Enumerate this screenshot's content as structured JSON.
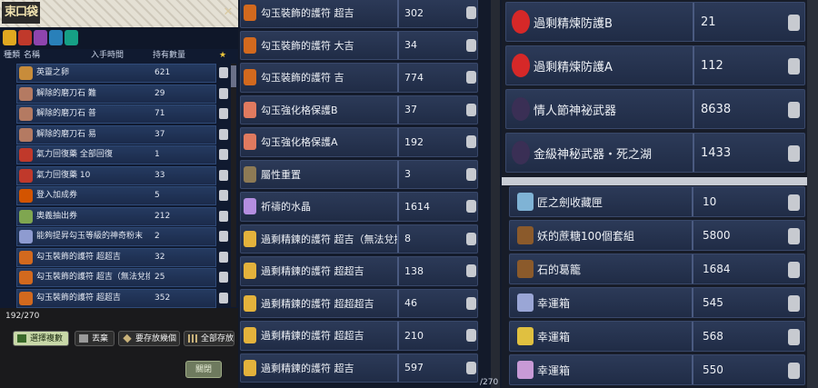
{
  "inventory": {
    "title": "束口袋",
    "close_glyph": "✕",
    "headers": {
      "type": "種類",
      "name": "名稱",
      "date": "入手時間",
      "qty": "持有數量",
      "star": "★"
    },
    "items": [
      {
        "name": "英靈之卵",
        "qty": "621",
        "color": "#c88c3a"
      },
      {
        "name": "解除的磨刀石 難",
        "qty": "29",
        "color": "#b47a62"
      },
      {
        "name": "解除的磨刀石 普",
        "qty": "71",
        "color": "#b47a62"
      },
      {
        "name": "解除的磨刀石 易",
        "qty": "37",
        "color": "#b47a62"
      },
      {
        "name": "氣力回復藥 全部回復",
        "qty": "1",
        "color": "#c0392b"
      },
      {
        "name": "氣力回復藥 10",
        "qty": "33",
        "color": "#c0392b"
      },
      {
        "name": "登入加成券",
        "qty": "5",
        "color": "#d35400"
      },
      {
        "name": "奧義抽出券",
        "qty": "212",
        "color": "#7fa650"
      },
      {
        "name": "能夠提昇勾玉等級的神奇粉末",
        "qty": "2",
        "color": "#8e9bd0"
      },
      {
        "name": "勾玉裝飾的護符 超超吉",
        "qty": "32",
        "color": "#d2691e"
      },
      {
        "name": "勾玉裝飾的護符 超吉（無法兌換為點數）",
        "qty": "25",
        "color": "#d2691e"
      },
      {
        "name": "勾玉裝飾的護符 超超吉",
        "qty": "352",
        "color": "#d2691e"
      }
    ],
    "count": "192/270",
    "buttons": [
      {
        "label": "選擇複數",
        "icon": "multi-select-icon"
      },
      {
        "label": "丟棄",
        "icon": "trash-icon"
      },
      {
        "label": "要存放幾個",
        "icon": "diamond-icon"
      },
      {
        "label": "全部存放",
        "icon": "grid-icon"
      }
    ],
    "close_button": "關閉"
  },
  "middle": {
    "rows": [
      {
        "name": "勾玉裝飾的護符 超吉",
        "qty": "302",
        "color": "#d2691e"
      },
      {
        "name": "勾玉裝飾的護符 大吉",
        "qty": "34",
        "color": "#d2691e"
      },
      {
        "name": "勾玉裝飾的護符 吉",
        "qty": "774",
        "color": "#d2691e"
      },
      {
        "name": "勾玉強化格保護B",
        "qty": "37",
        "color": "#e07a5f"
      },
      {
        "name": "勾玉強化格保護A",
        "qty": "192",
        "color": "#e07a5f"
      },
      {
        "name": "屬性重置",
        "qty": "3",
        "color": "#8d7a55"
      },
      {
        "name": "祈禱的水晶",
        "qty": "1614",
        "color": "#b48ee0"
      },
      {
        "name": "過剩精鍊的護符 超吉（無法兌換為點數）",
        "qty": "8",
        "color": "#e3b23c"
      },
      {
        "name": "過剩精鍊的護符 超超吉",
        "qty": "138",
        "color": "#e3b23c"
      },
      {
        "name": "過剩精鍊的護符 超超超吉",
        "qty": "46",
        "color": "#e3b23c"
      },
      {
        "name": "過剩精鍊的護符 超超吉",
        "qty": "210",
        "color": "#e3b23c"
      },
      {
        "name": "過剩精鍊的護符 超吉",
        "qty": "597",
        "color": "#e3b23c"
      }
    ],
    "count_partial": "/270"
  },
  "right_top": {
    "rows": [
      {
        "name": "過剩精煉防護B",
        "qty": "21",
        "color": "#d62828"
      },
      {
        "name": "過剩精煉防護A",
        "qty": "112",
        "color": "#d62828"
      },
      {
        "name": "情人節神祕武器",
        "qty": "8638",
        "color": "#3a2f55"
      },
      {
        "name": "金級神秘武器・死之湖",
        "qty": "1433",
        "color": "#3a2f55"
      }
    ]
  },
  "right_bottom": {
    "rows": [
      {
        "name": "匠之劍收藏匣",
        "qty": "10",
        "color": "#7fb3d5"
      },
      {
        "name": "妖的蔗糖100個套組",
        "qty": "5800",
        "color": "#8b5a2b"
      },
      {
        "name": "石的葛籠",
        "qty": "1684",
        "color": "#8b5a2b"
      },
      {
        "name": "幸運箱",
        "qty": "545",
        "color": "#9aa6d6"
      },
      {
        "name": "幸運箱",
        "qty": "568",
        "color": "#e0c040"
      },
      {
        "name": "幸運箱",
        "qty": "550",
        "color": "#c89ad6"
      }
    ]
  }
}
